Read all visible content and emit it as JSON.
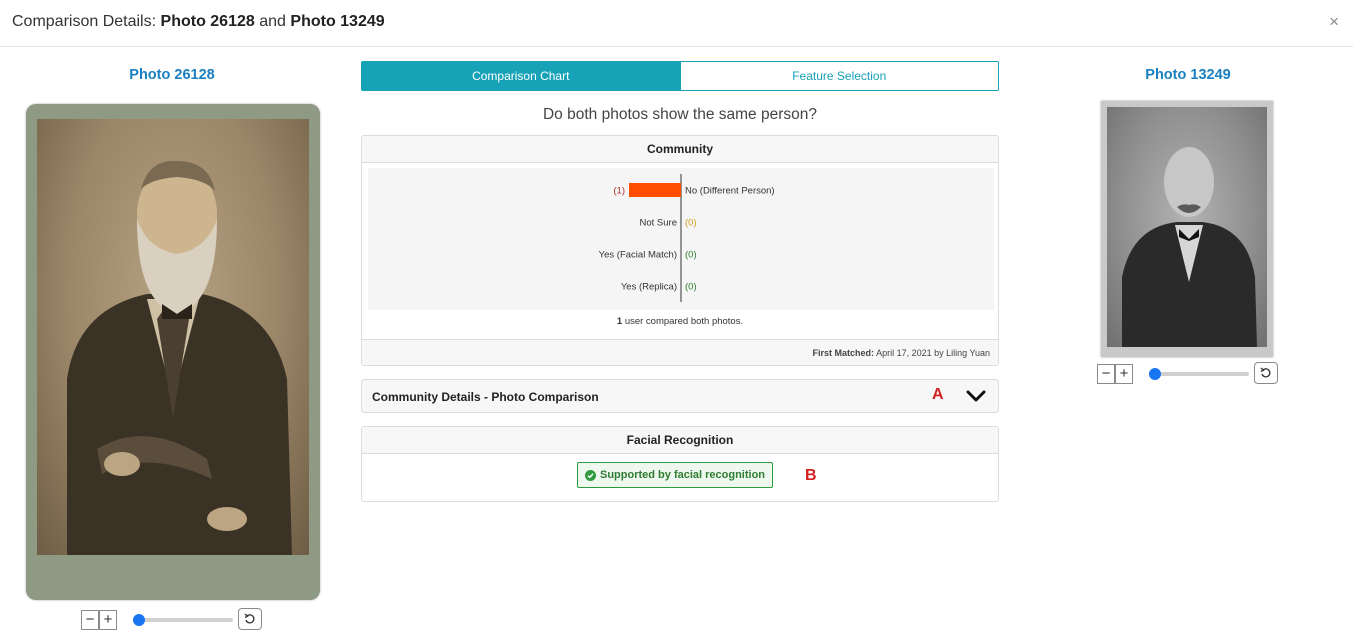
{
  "header": {
    "title_prefix": "Comparison Details:",
    "photo_a": "Photo 26128",
    "joiner": "and",
    "photo_b": "Photo 13249",
    "close_symbol": "×"
  },
  "left_photo": {
    "label": "Photo 26128",
    "zoom_level": 0
  },
  "right_photo": {
    "label": "Photo 13249",
    "zoom_level": 0
  },
  "zoom": {
    "minus": "−",
    "plus": "+"
  },
  "tabs": [
    {
      "label": "Comparison Chart",
      "active": true
    },
    {
      "label": "Feature Selection",
      "active": false
    }
  ],
  "question": "Do both photos show the same person?",
  "community": {
    "title": "Community",
    "compared_count": "1",
    "compared_text": "user compared both photos.",
    "first_matched_label": "First Matched:",
    "first_matched_value": "April 17, 2021 by Liling Yuan"
  },
  "chart_data": {
    "type": "bar",
    "orientation": "diverging-horizontal",
    "categories": [
      "No (Different Person)",
      "Not Sure",
      "Yes (Facial Match)",
      "Yes (Replica)"
    ],
    "values": [
      1,
      0,
      0,
      0
    ],
    "value_labels": [
      "(1)",
      "(0)",
      "(0)",
      "(0)"
    ],
    "colors": [
      "#ff4d00",
      "#e0a400",
      "#2e8b3a",
      "#2e8b3a"
    ],
    "label_colors": [
      "#b03030",
      "#d4a017",
      "#2e7d32",
      "#2e7d32"
    ],
    "max": 1
  },
  "details": {
    "title": "Community Details - Photo Comparison",
    "marker": "A",
    "icon": "chevron-down-icon"
  },
  "facial": {
    "title": "Facial Recognition",
    "badge": "Supported by facial recognition",
    "marker": "B",
    "icon": "check-circle-icon"
  },
  "colors": {
    "accent": "#17a2b8",
    "link": "#1a7fc1",
    "marker": "#d42020",
    "success": "#2e9b3e"
  }
}
